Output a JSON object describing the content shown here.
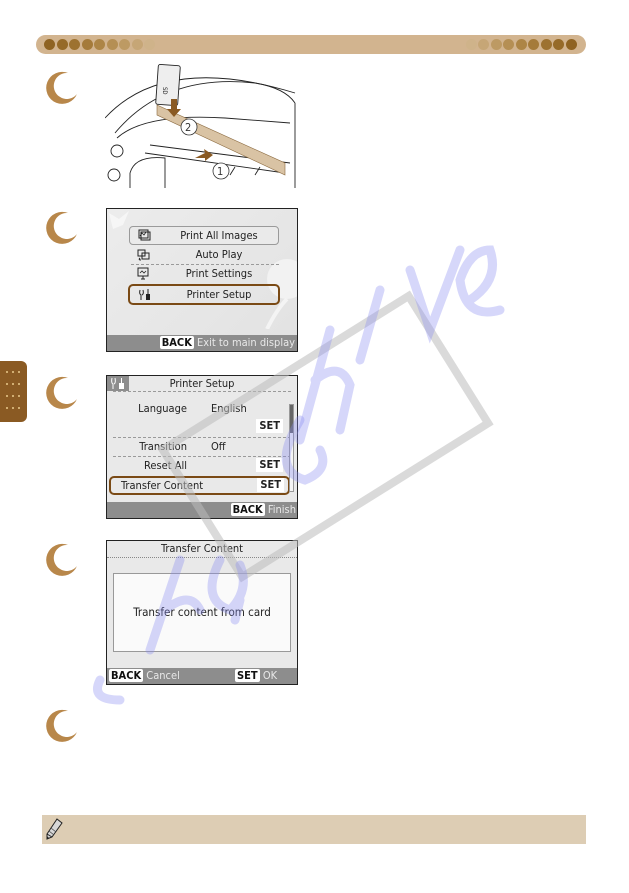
{
  "header": {
    "bar_color": "#d2b48f",
    "dot_colors_left": [
      "#8f6322",
      "#966a28",
      "#9d7230",
      "#a57b3a",
      "#ad8546",
      "#b58f54",
      "#bd9a63",
      "#c6a676",
      "#cfb38a"
    ],
    "dot_colors_right": [
      "#cfb38a",
      "#c6a676",
      "#bd9a63",
      "#b58f54",
      "#ad8546",
      "#a57b3a",
      "#9d7230",
      "#966a28",
      "#8f6322"
    ]
  },
  "side_tab": {
    "color": "#8a5a23"
  },
  "steps": [
    {
      "id": 1,
      "illustration": {
        "description": "memory card insertion into printer slot",
        "callouts": [
          "①",
          "②"
        ],
        "card_label": "SD"
      }
    },
    {
      "id": 2,
      "screen": {
        "items": [
          {
            "label": "Print All Images",
            "icon": "print-all-images-icon",
            "highlighted": false,
            "boxed": true
          },
          {
            "label": "Auto Play",
            "icon": "auto-play-icon",
            "highlighted": false,
            "boxed": false
          },
          {
            "label": "Print Settings",
            "icon": "print-settings-icon",
            "highlighted": false,
            "boxed": false
          },
          {
            "label": "Printer Setup",
            "icon": "printer-setup-icon",
            "highlighted": true,
            "boxed": false
          }
        ],
        "footer": {
          "button": "BACK",
          "text": "Exit to main display"
        }
      }
    },
    {
      "id": 3,
      "screen": {
        "title": "Printer Setup",
        "rows": [
          {
            "label": "Language",
            "value": "English",
            "set": ""
          },
          {
            "label": "",
            "value": "",
            "set": "SET"
          },
          {
            "label": "Transition",
            "value": "Off",
            "set": ""
          },
          {
            "label": "Reset All",
            "value": "",
            "set": "SET"
          },
          {
            "label": "Transfer Content",
            "value": "",
            "set": "SET",
            "highlighted": true
          }
        ],
        "footer": {
          "button": "BACK",
          "text": "Finish"
        }
      }
    },
    {
      "id": 4,
      "screen": {
        "title": "Transfer Content",
        "message": "Transfer content from card",
        "footer": {
          "left_button": "BACK",
          "left_text": "Cancel",
          "right_button": "SET",
          "right_text": "OK"
        }
      }
    },
    {
      "id": 5
    }
  ],
  "note": {
    "icon": "pencil-icon",
    "color": "#ddcdb4"
  },
  "accent_color": "#b8874a",
  "highlight_color": "#7a4a15"
}
